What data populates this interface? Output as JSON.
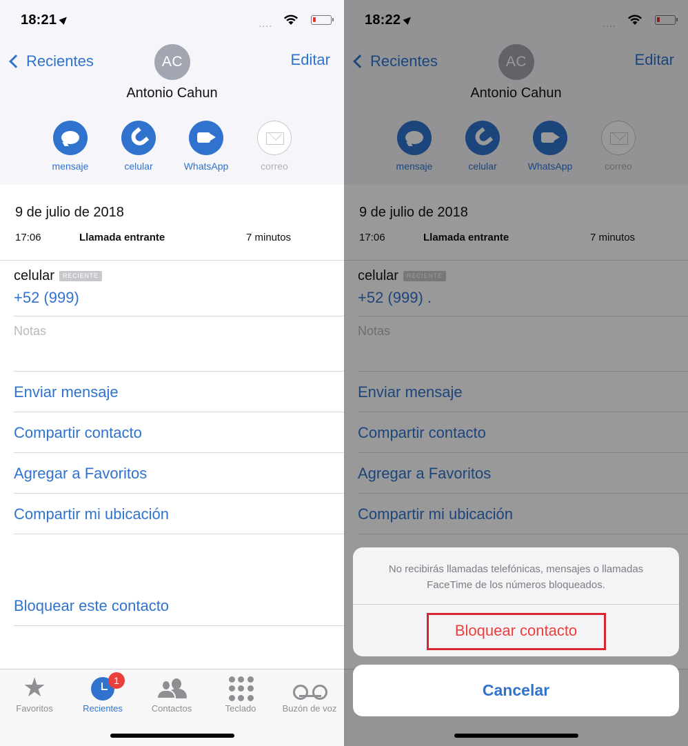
{
  "colors": {
    "accent": "#2f73cf",
    "destructive": "#e8403d",
    "badge": "#e8403d",
    "highlight": "#d8262e"
  },
  "left": {
    "status": {
      "time": "18:21",
      "signal_dots": "...."
    }
  },
  "right": {
    "status": {
      "time": "18:22",
      "signal_dots": "...."
    },
    "phone_suffix": "."
  },
  "nav": {
    "back_label": "Recientes",
    "edit_label": "Editar"
  },
  "contact": {
    "initials": "AC",
    "name": "Antonio Cahun"
  },
  "actions": [
    {
      "label": "mensaje",
      "icon": "message-bubble-icon",
      "enabled": true
    },
    {
      "label": "celular",
      "icon": "phone-icon",
      "enabled": true
    },
    {
      "label": "WhatsApp",
      "icon": "video-camera-icon",
      "enabled": true
    },
    {
      "label": "correo",
      "icon": "mail-icon",
      "enabled": false
    }
  ],
  "call_log": {
    "date": "9 de julio de 2018",
    "time": "17:06",
    "type": "Llamada entrante",
    "duration": "7 minutos"
  },
  "phone": {
    "label": "celular",
    "badge": "RECIENTE",
    "number": "+52 (999)"
  },
  "notes_placeholder": "Notas",
  "links": {
    "send_message": "Enviar mensaje",
    "share_contact": "Compartir contacto",
    "add_favorites": "Agregar a Favoritos",
    "share_location": "Compartir mi ubicación",
    "block": "Bloquear este contacto"
  },
  "tabbar": {
    "items": [
      {
        "label": "Favoritos",
        "icon": "star-icon",
        "active": false
      },
      {
        "label": "Recientes",
        "icon": "clock-icon",
        "active": true,
        "badge": "1"
      },
      {
        "label": "Contactos",
        "icon": "contacts-icon",
        "active": false
      },
      {
        "label": "Teclado",
        "icon": "keypad-icon",
        "active": false
      },
      {
        "label": "Buzón de voz",
        "icon": "voicemail-icon",
        "active": false
      }
    ]
  },
  "action_sheet": {
    "message": "No recibirás llamadas telefónicas, mensajes o llamadas FaceTime de los números bloqueados.",
    "confirm_label": "Bloquear contacto",
    "cancel_label": "Cancelar"
  }
}
